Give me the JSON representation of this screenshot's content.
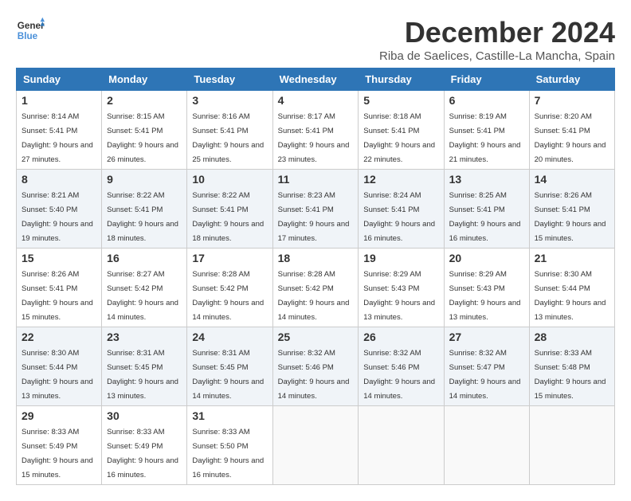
{
  "logo": {
    "line1": "General",
    "line2": "Blue"
  },
  "title": "December 2024",
  "location": "Riba de Saelices, Castille-La Mancha, Spain",
  "weekdays": [
    "Sunday",
    "Monday",
    "Tuesday",
    "Wednesday",
    "Thursday",
    "Friday",
    "Saturday"
  ],
  "weeks": [
    [
      {
        "day": "1",
        "sunrise": "8:14 AM",
        "sunset": "5:41 PM",
        "daylight": "9 hours and 27 minutes."
      },
      {
        "day": "2",
        "sunrise": "8:15 AM",
        "sunset": "5:41 PM",
        "daylight": "9 hours and 26 minutes."
      },
      {
        "day": "3",
        "sunrise": "8:16 AM",
        "sunset": "5:41 PM",
        "daylight": "9 hours and 25 minutes."
      },
      {
        "day": "4",
        "sunrise": "8:17 AM",
        "sunset": "5:41 PM",
        "daylight": "9 hours and 23 minutes."
      },
      {
        "day": "5",
        "sunrise": "8:18 AM",
        "sunset": "5:41 PM",
        "daylight": "9 hours and 22 minutes."
      },
      {
        "day": "6",
        "sunrise": "8:19 AM",
        "sunset": "5:41 PM",
        "daylight": "9 hours and 21 minutes."
      },
      {
        "day": "7",
        "sunrise": "8:20 AM",
        "sunset": "5:41 PM",
        "daylight": "9 hours and 20 minutes."
      }
    ],
    [
      {
        "day": "8",
        "sunrise": "8:21 AM",
        "sunset": "5:40 PM",
        "daylight": "9 hours and 19 minutes."
      },
      {
        "day": "9",
        "sunrise": "8:22 AM",
        "sunset": "5:41 PM",
        "daylight": "9 hours and 18 minutes."
      },
      {
        "day": "10",
        "sunrise": "8:22 AM",
        "sunset": "5:41 PM",
        "daylight": "9 hours and 18 minutes."
      },
      {
        "day": "11",
        "sunrise": "8:23 AM",
        "sunset": "5:41 PM",
        "daylight": "9 hours and 17 minutes."
      },
      {
        "day": "12",
        "sunrise": "8:24 AM",
        "sunset": "5:41 PM",
        "daylight": "9 hours and 16 minutes."
      },
      {
        "day": "13",
        "sunrise": "8:25 AM",
        "sunset": "5:41 PM",
        "daylight": "9 hours and 16 minutes."
      },
      {
        "day": "14",
        "sunrise": "8:26 AM",
        "sunset": "5:41 PM",
        "daylight": "9 hours and 15 minutes."
      }
    ],
    [
      {
        "day": "15",
        "sunrise": "8:26 AM",
        "sunset": "5:41 PM",
        "daylight": "9 hours and 15 minutes."
      },
      {
        "day": "16",
        "sunrise": "8:27 AM",
        "sunset": "5:42 PM",
        "daylight": "9 hours and 14 minutes."
      },
      {
        "day": "17",
        "sunrise": "8:28 AM",
        "sunset": "5:42 PM",
        "daylight": "9 hours and 14 minutes."
      },
      {
        "day": "18",
        "sunrise": "8:28 AM",
        "sunset": "5:42 PM",
        "daylight": "9 hours and 14 minutes."
      },
      {
        "day": "19",
        "sunrise": "8:29 AM",
        "sunset": "5:43 PM",
        "daylight": "9 hours and 13 minutes."
      },
      {
        "day": "20",
        "sunrise": "8:29 AM",
        "sunset": "5:43 PM",
        "daylight": "9 hours and 13 minutes."
      },
      {
        "day": "21",
        "sunrise": "8:30 AM",
        "sunset": "5:44 PM",
        "daylight": "9 hours and 13 minutes."
      }
    ],
    [
      {
        "day": "22",
        "sunrise": "8:30 AM",
        "sunset": "5:44 PM",
        "daylight": "9 hours and 13 minutes."
      },
      {
        "day": "23",
        "sunrise": "8:31 AM",
        "sunset": "5:45 PM",
        "daylight": "9 hours and 13 minutes."
      },
      {
        "day": "24",
        "sunrise": "8:31 AM",
        "sunset": "5:45 PM",
        "daylight": "9 hours and 14 minutes."
      },
      {
        "day": "25",
        "sunrise": "8:32 AM",
        "sunset": "5:46 PM",
        "daylight": "9 hours and 14 minutes."
      },
      {
        "day": "26",
        "sunrise": "8:32 AM",
        "sunset": "5:46 PM",
        "daylight": "9 hours and 14 minutes."
      },
      {
        "day": "27",
        "sunrise": "8:32 AM",
        "sunset": "5:47 PM",
        "daylight": "9 hours and 14 minutes."
      },
      {
        "day": "28",
        "sunrise": "8:33 AM",
        "sunset": "5:48 PM",
        "daylight": "9 hours and 15 minutes."
      }
    ],
    [
      {
        "day": "29",
        "sunrise": "8:33 AM",
        "sunset": "5:49 PM",
        "daylight": "9 hours and 15 minutes."
      },
      {
        "day": "30",
        "sunrise": "8:33 AM",
        "sunset": "5:49 PM",
        "daylight": "9 hours and 16 minutes."
      },
      {
        "day": "31",
        "sunrise": "8:33 AM",
        "sunset": "5:50 PM",
        "daylight": "9 hours and 16 minutes."
      },
      null,
      null,
      null,
      null
    ]
  ]
}
